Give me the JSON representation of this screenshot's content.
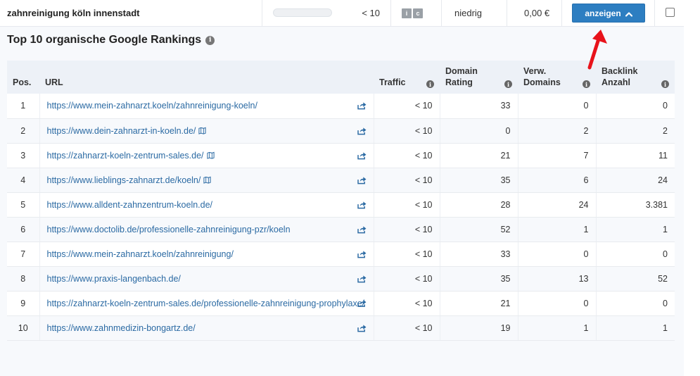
{
  "keyword_row": {
    "keyword": "zahnreinigung köln innenstadt",
    "traffic": "< 10",
    "badges": [
      "i",
      "c"
    ],
    "competition": "niedrig",
    "cpc": "0,00 €",
    "button_label": "anzeigen"
  },
  "section_title": "Top 10 organische Google Rankings",
  "columns": {
    "pos": "Pos.",
    "url": "URL",
    "traffic": "Traffic",
    "domain_rating_1": "Domain",
    "domain_rating_2": "Rating",
    "ref_domains_1": "Verw.",
    "ref_domains_2": "Domains",
    "backlinks_1": "Backlink",
    "backlinks_2": "Anzahl"
  },
  "rows": [
    {
      "pos": "1",
      "url": "https://www.mein-zahnarzt.koeln/zahnreinigung-koeln/",
      "traffic": "< 10",
      "dr": "33",
      "rd": "0",
      "bl": "0"
    },
    {
      "pos": "2",
      "url": "https://www.dein-zahnarzt-in-koeln.de/",
      "traffic": "< 10",
      "dr": "0",
      "rd": "2",
      "bl": "2"
    },
    {
      "pos": "3",
      "url": "https://zahnarzt-koeln-zentrum-sales.de/",
      "traffic": "< 10",
      "dr": "21",
      "rd": "7",
      "bl": "11"
    },
    {
      "pos": "4",
      "url": "https://www.lieblings-zahnarzt.de/koeln/",
      "traffic": "< 10",
      "dr": "35",
      "rd": "6",
      "bl": "24"
    },
    {
      "pos": "5",
      "url": "https://www.alldent-zahnzentrum-koeln.de/",
      "traffic": "< 10",
      "dr": "28",
      "rd": "24",
      "bl": "3.381"
    },
    {
      "pos": "6",
      "url": "https://www.doctolib.de/professionelle-zahnreinigung-pzr/koeln",
      "traffic": "< 10",
      "dr": "52",
      "rd": "1",
      "bl": "1"
    },
    {
      "pos": "7",
      "url": "https://www.mein-zahnarzt.koeln/zahnreinigung/",
      "traffic": "< 10",
      "dr": "33",
      "rd": "0",
      "bl": "0"
    },
    {
      "pos": "8",
      "url": "https://www.praxis-langenbach.de/",
      "traffic": "< 10",
      "dr": "35",
      "rd": "13",
      "bl": "52"
    },
    {
      "pos": "9",
      "url": "https://zahnarzt-koeln-zentrum-sales.de/professionelle-zahnreinigung-prophylaxe/",
      "traffic": "< 10",
      "dr": "21",
      "rd": "0",
      "bl": "0"
    },
    {
      "pos": "10",
      "url": "https://www.zahnmedizin-bongartz.de/",
      "traffic": "< 10",
      "dr": "19",
      "rd": "1",
      "bl": "1"
    }
  ],
  "colors": {
    "accent": "#2d7ec1",
    "link": "#2b6aa3",
    "arrow": "#e8131b"
  },
  "icons": {
    "external": "share-arrow-icon",
    "map": "map-icon",
    "info": "info-icon"
  }
}
